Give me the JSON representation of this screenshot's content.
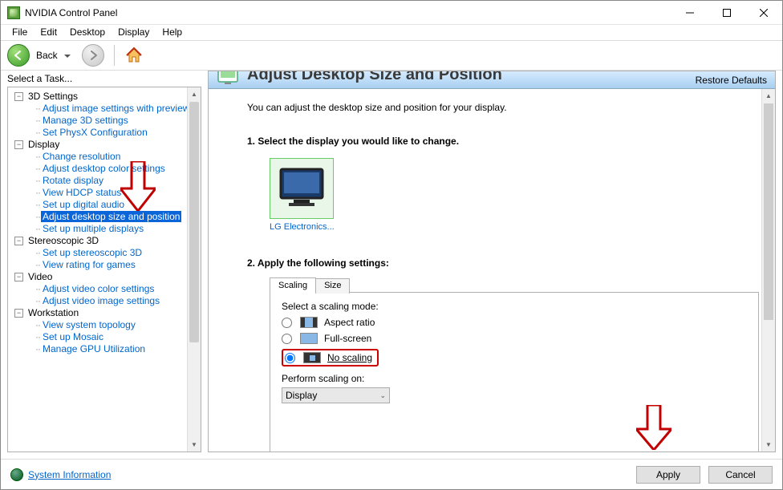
{
  "window": {
    "title": "NVIDIA Control Panel"
  },
  "menu": {
    "items": [
      "File",
      "Edit",
      "Desktop",
      "Display",
      "Help"
    ]
  },
  "toolbar": {
    "back_label": "Back"
  },
  "sidebar": {
    "title": "Select a Task...",
    "groups": [
      {
        "label": "3D Settings",
        "items": [
          "Adjust image settings with preview",
          "Manage 3D settings",
          "Set PhysX Configuration"
        ]
      },
      {
        "label": "Display",
        "items": [
          "Change resolution",
          "Adjust desktop color settings",
          "Rotate display",
          "View HDCP status",
          "Set up digital audio",
          "Adjust desktop size and position",
          "Set up multiple displays"
        ],
        "selected_index": 5
      },
      {
        "label": "Stereoscopic 3D",
        "items": [
          "Set up stereoscopic 3D",
          "View rating for games"
        ]
      },
      {
        "label": "Video",
        "items": [
          "Adjust video color settings",
          "Adjust video image settings"
        ]
      },
      {
        "label": "Workstation",
        "items": [
          "View system topology",
          "Set up Mosaic",
          "Manage GPU Utilization"
        ]
      }
    ]
  },
  "content": {
    "header_title": "Adjust Desktop Size and Position",
    "restore": "Restore Defaults",
    "intro": "You can adjust the desktop size and position for your display.",
    "step1": "1. Select the display you would like to change.",
    "monitor_label": "LG Electronics...",
    "step2": "2. Apply the following settings:",
    "tabs": {
      "scaling": "Scaling",
      "size": "Size"
    },
    "scaling": {
      "mode_label": "Select a scaling mode:",
      "options": {
        "aspect": "Aspect ratio",
        "full": "Full-screen",
        "none": "No scaling"
      },
      "selected": "none",
      "perform_label": "Perform scaling on:",
      "perform_value": "Display"
    }
  },
  "footer": {
    "sys_info": "System Information",
    "apply": "Apply",
    "cancel": "Cancel"
  },
  "annotations": {
    "arrow_tree": true,
    "no_scaling_box": true,
    "arrow_apply": true
  }
}
